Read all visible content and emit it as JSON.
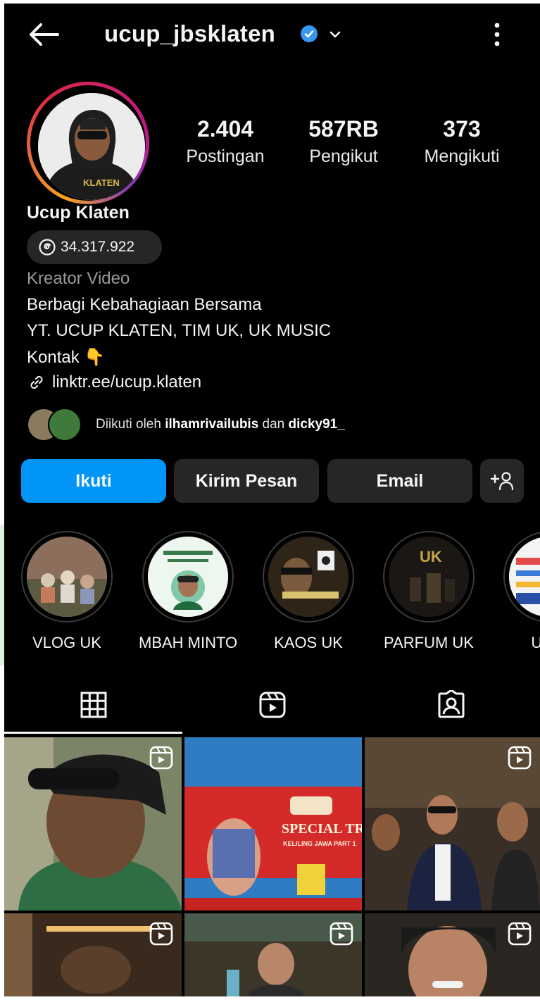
{
  "header": {
    "username": "ucup_jbsklaten",
    "verified_color": "#3897f0"
  },
  "stats": [
    {
      "value": "2.404",
      "label": "Postingan"
    },
    {
      "value": "587RB",
      "label": "Pengikut"
    },
    {
      "value": "373",
      "label": "Mengikuti"
    }
  ],
  "profile": {
    "full_name": "Ucup Klaten",
    "threads_count": "34.317.922",
    "category": "Kreator Video",
    "bio_line1": "Berbagi Kebahagiaan Bersama",
    "bio_line2": "YT. UCUP KLATEN, TIM UK, UK MUSIC",
    "bio_line3": "Kontak",
    "bio_emoji": "👇",
    "link": "linktr.ee/ucup.klaten"
  },
  "followed_by": {
    "prefix": "Diikuti oleh",
    "user1": "ilhamrivailubis",
    "conj": "dan",
    "user2": "dicky91_"
  },
  "actions": {
    "follow": "Ikuti",
    "message": "Kirim Pesan",
    "email": "Email"
  },
  "highlights": [
    {
      "label": "VLOG UK"
    },
    {
      "label": "MBAH MINTO"
    },
    {
      "label": "KAOS UK"
    },
    {
      "label": "PARFUM UK"
    },
    {
      "label": "UK S"
    }
  ],
  "tabs": [
    "grid",
    "reels",
    "tagged"
  ],
  "posts": {
    "tile2_title": "SPECIAL TRIP",
    "tile2_sub": "KELILING JAWA PART 1"
  },
  "colors": {
    "accent": "#0095f6",
    "button_dark": "#262626",
    "background": "#000000"
  }
}
